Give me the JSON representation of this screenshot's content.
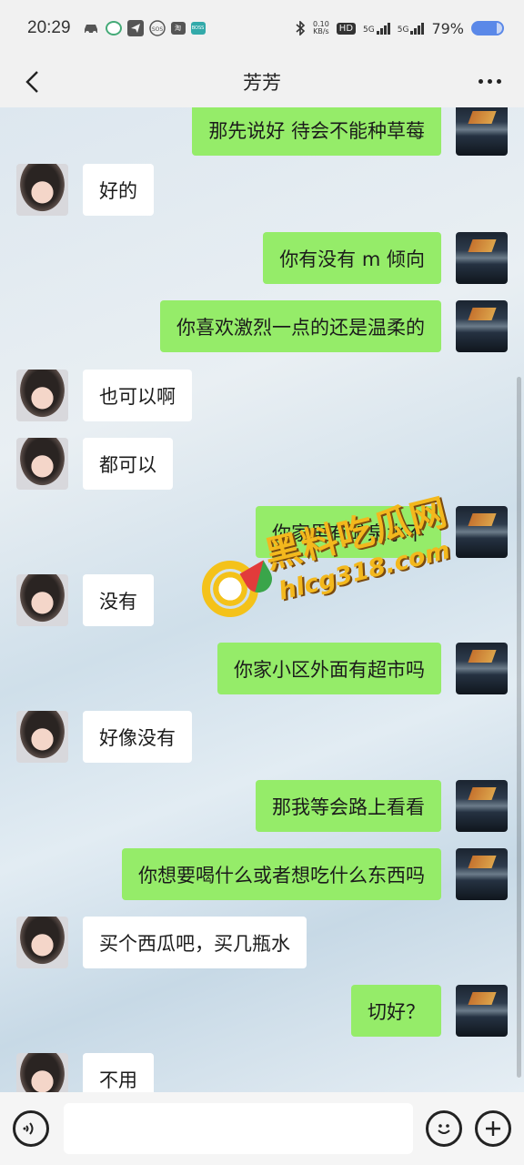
{
  "statusbar": {
    "time": "20:29",
    "net_speed_value": "0.10",
    "net_speed_unit": "KB/s",
    "hd_label": "HD",
    "signal1_label": "5G",
    "signal2_label": "5G",
    "battery": "79%",
    "notif_icons": [
      "car-icon",
      "k-app-icon",
      "telegram-icon",
      "sos-icon",
      "taobao-icon",
      "boss-icon"
    ],
    "taobao_label": "淘",
    "boss_label": "BOSS"
  },
  "header": {
    "title": "芳芳",
    "back_icon": "chevron-left-icon",
    "more_icon": "more-dots-icon"
  },
  "messages": [
    {
      "side": "right",
      "text": "那先说好  待会不能种草莓"
    },
    {
      "side": "left",
      "text": "好的"
    },
    {
      "side": "right",
      "text": "你有没有 m 倾向"
    },
    {
      "side": "right",
      "text": "你喜欢激烈一点的还是温柔的"
    },
    {
      "side": "left",
      "text": "也可以啊"
    },
    {
      "side": "left",
      "text": "都可以"
    },
    {
      "side": "right",
      "text": "你家里有矿泉水不"
    },
    {
      "side": "left",
      "text": "没有"
    },
    {
      "side": "right",
      "text": "你家小区外面有超市吗"
    },
    {
      "side": "left",
      "text": "好像没有"
    },
    {
      "side": "right",
      "text": "那我等会路上看看"
    },
    {
      "side": "right",
      "text": "你想要喝什么或者想吃什么东西吗"
    },
    {
      "side": "left",
      "text": "买个西瓜吧，买几瓶水"
    },
    {
      "side": "right",
      "text": "切好？"
    },
    {
      "side": "left",
      "text": "不用"
    }
  ],
  "watermark": {
    "title": "黑料吃瓜网",
    "url": "hlcg318.com"
  },
  "inputbar": {
    "voice_icon": "voice-icon",
    "emoji_icon": "emoji-icon",
    "plus_icon": "plus-icon",
    "input_value": ""
  },
  "colors": {
    "sent_bubble": "#95ec69",
    "received_bubble": "#ffffff",
    "bar_bg": "#f1f1f1",
    "battery": "#5a88e8",
    "watermark": "#f3b81d"
  }
}
